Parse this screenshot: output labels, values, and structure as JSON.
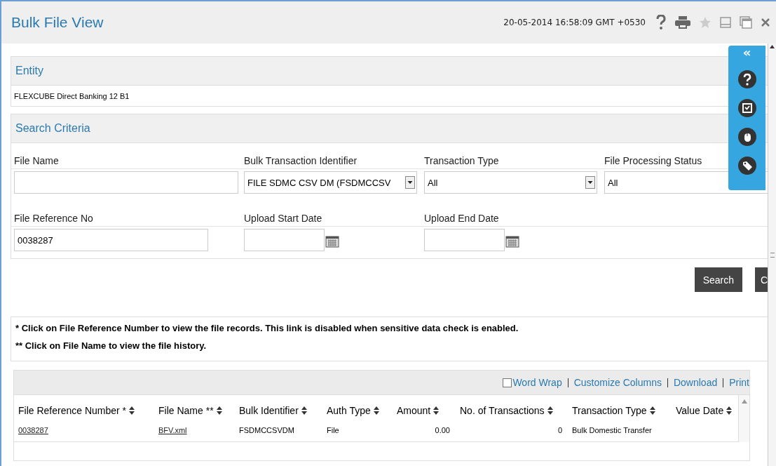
{
  "window": {
    "title": "Bulk File View",
    "timestamp": "20-05-2014 16:58:09 GMT +0530"
  },
  "entity": {
    "heading": "Entity",
    "value": "FLEXCUBE Direct Banking 12 B1"
  },
  "search_criteria": {
    "heading": "Search Criteria",
    "rows": [
      [
        {
          "label": "File Name",
          "kind": "text"
        },
        {
          "label": "Bulk Transaction Identifier",
          "kind": "select",
          "value": "FILE SDMC CSV DM (FSDMCCSV"
        },
        {
          "label": "Transaction Type",
          "kind": "select",
          "value": "All"
        },
        {
          "label": "File Processing Status",
          "kind": "select",
          "value": "All"
        }
      ],
      [
        {
          "label": "File Reference No",
          "kind": "text",
          "value": "0038287"
        },
        {
          "label": "Upload Start Date",
          "kind": "date"
        },
        {
          "label": "Upload End Date",
          "kind": "date"
        }
      ]
    ]
  },
  "buttons": [
    "Search",
    "C"
  ],
  "notes": [
    "* Click on File Reference Number to view the file records. This link is disabled when sensitive data check is enabled.",
    "** Click on File Name to view the file history."
  ],
  "grid_toolbar": {
    "word_wrap": {
      "label": "Word Wrap",
      "checked": false
    },
    "links": [
      "Customize Columns",
      "Download",
      "Print"
    ]
  },
  "table": {
    "columns": [
      "File Reference Number *",
      "File Name **",
      "Bulk Identifier",
      "Auth Type",
      "Amount",
      "No. of Transactions",
      "Transaction Type",
      "Value Date"
    ],
    "rows": [
      [
        "0038287",
        "BFV.xml",
        "FSDMCCSVDM",
        "File",
        "0.00",
        "0",
        "Bulk Domestic Transfer"
      ]
    ]
  },
  "side_panel": {
    "collapse": "«"
  }
}
